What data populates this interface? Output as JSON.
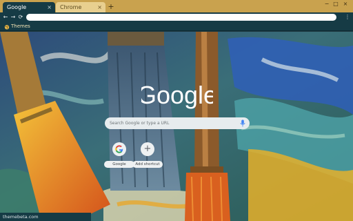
{
  "tabs": [
    {
      "title": "Google",
      "close": "×"
    },
    {
      "title": "Chrome",
      "close": "×"
    }
  ],
  "new_tab": "+",
  "window_controls": {
    "minimize": "−",
    "maximize": "□",
    "close": "×"
  },
  "toolbar": {
    "back": "←",
    "forward": "→",
    "reload": "⟳",
    "menu": "⋮"
  },
  "bookmarks": [
    {
      "label": "Themes",
      "icon": "themes-folder-icon"
    }
  ],
  "ntp": {
    "logo_text": "Google",
    "search_placeholder": "Search Google or type a URL",
    "shortcuts": [
      {
        "label": "Google",
        "icon": "google-g-icon"
      },
      {
        "label": "Add shortcut",
        "icon": "plus-icon",
        "glyph": "+"
      }
    ]
  },
  "credit": "themebeta.com",
  "colors": {
    "frame": "#c9a24e",
    "toolbar": "#163b45",
    "inactive_tab": "#e8cf8f",
    "bookmark_text": "#f1e3b4"
  }
}
